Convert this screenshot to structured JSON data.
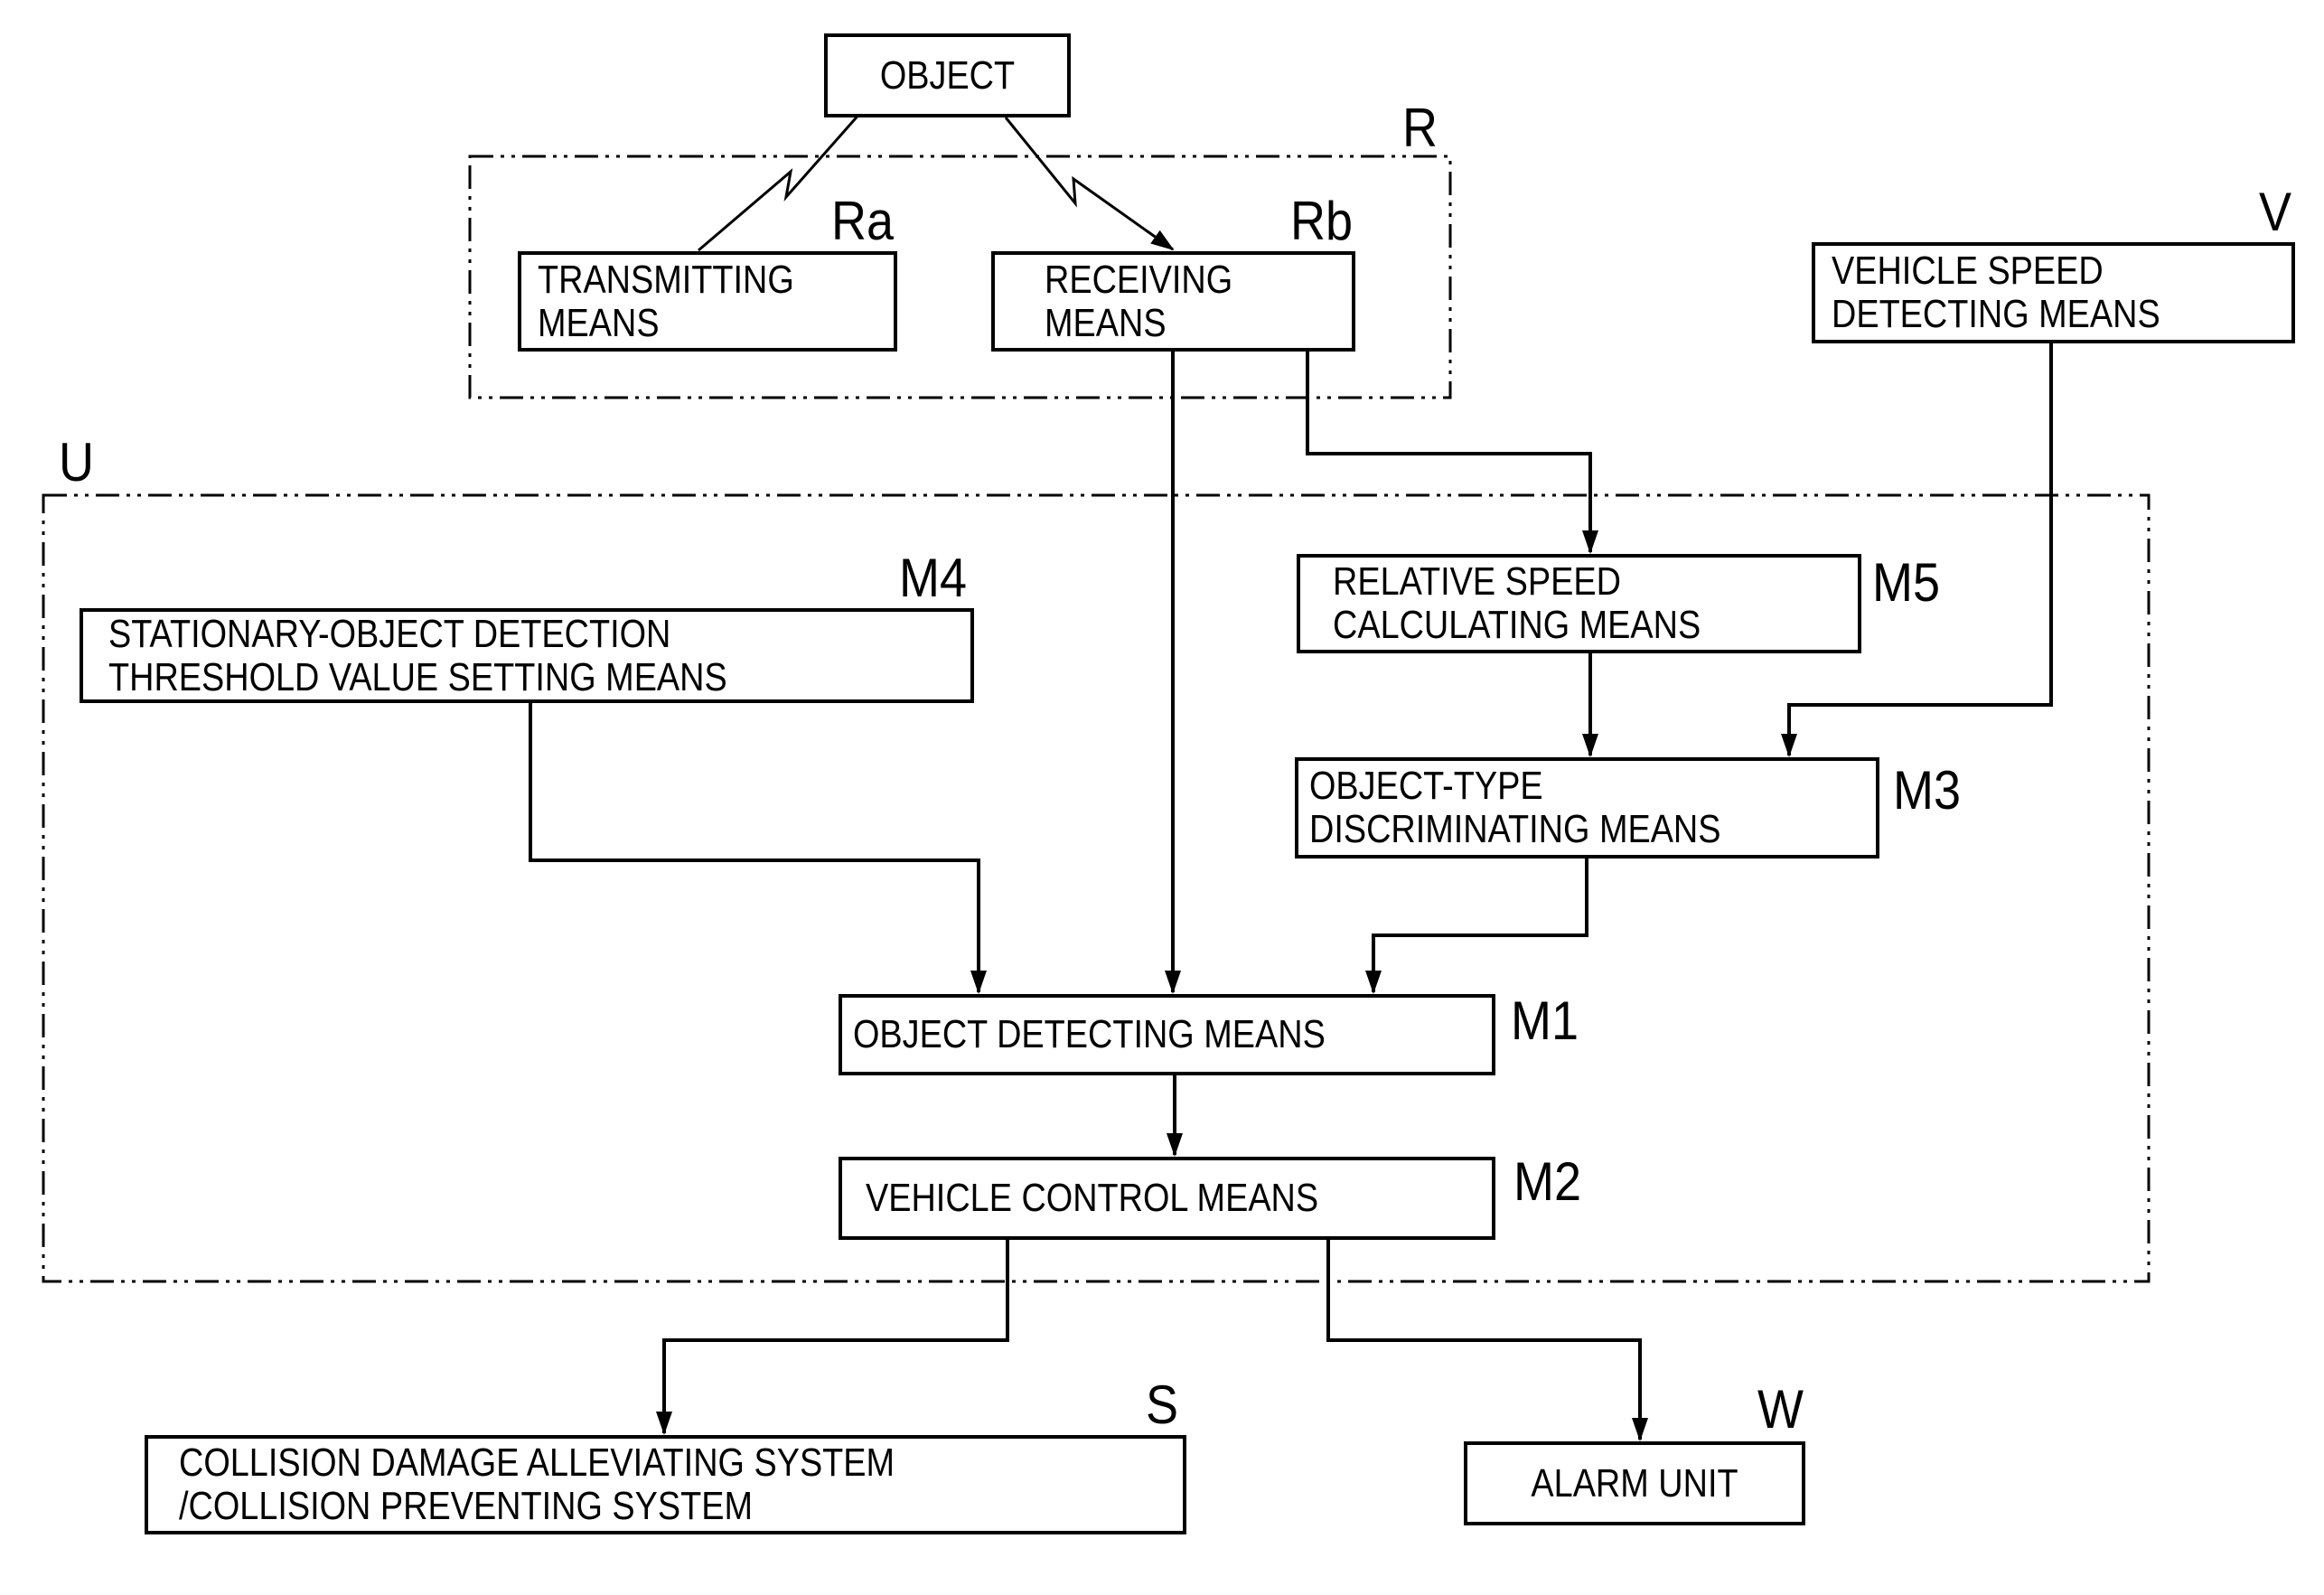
{
  "diagram": {
    "groups": {
      "R": {
        "label": "R"
      },
      "U": {
        "label": "U"
      }
    },
    "blocks": {
      "object": {
        "lines": [
          "OBJECT"
        ]
      },
      "transmitting": {
        "ref": "Ra",
        "lines": [
          "TRANSMITTING",
          "MEANS"
        ]
      },
      "receiving": {
        "ref": "Rb",
        "lines": [
          "RECEIVING",
          "MEANS"
        ]
      },
      "vehicle_speed": {
        "ref": "V",
        "lines": [
          "VEHICLE SPEED",
          "DETECTING MEANS"
        ]
      },
      "threshold": {
        "ref": "M4",
        "lines": [
          "STATIONARY-OBJECT DETECTION",
          "THRESHOLD VALUE SETTING MEANS"
        ]
      },
      "relative_speed": {
        "ref": "M5",
        "lines": [
          "RELATIVE SPEED",
          "CALCULATING MEANS"
        ]
      },
      "object_type": {
        "ref": "M3",
        "lines": [
          "OBJECT-TYPE",
          "DISCRIMINATING MEANS"
        ]
      },
      "object_detecting": {
        "ref": "M1",
        "lines": [
          "OBJECT DETECTING MEANS"
        ]
      },
      "vehicle_control": {
        "ref": "M2",
        "lines": [
          "VEHICLE CONTROL MEANS"
        ]
      },
      "collision_system": {
        "ref": "S",
        "lines": [
          "COLLISION DAMAGE ALLEVIATING SYSTEM",
          "/COLLISION PREVENTING SYSTEM"
        ]
      },
      "alarm_unit": {
        "ref": "W",
        "lines": [
          "ALARM UNIT"
        ]
      }
    },
    "connections": [
      {
        "from": "transmitting",
        "to": "object",
        "kind": "wireless"
      },
      {
        "from": "object",
        "to": "receiving",
        "kind": "wireless"
      },
      {
        "from": "receiving",
        "to": "object_detecting",
        "kind": "arrow"
      },
      {
        "from": "receiving",
        "to": "relative_speed",
        "kind": "arrow"
      },
      {
        "from": "vehicle_speed",
        "to": "object_type",
        "kind": "arrow"
      },
      {
        "from": "relative_speed",
        "to": "object_type",
        "kind": "arrow"
      },
      {
        "from": "threshold",
        "to": "object_detecting",
        "kind": "arrow"
      },
      {
        "from": "object_type",
        "to": "object_detecting",
        "kind": "arrow"
      },
      {
        "from": "object_detecting",
        "to": "vehicle_control",
        "kind": "arrow"
      },
      {
        "from": "vehicle_control",
        "to": "collision_system",
        "kind": "arrow"
      },
      {
        "from": "vehicle_control",
        "to": "alarm_unit",
        "kind": "arrow"
      }
    ]
  }
}
